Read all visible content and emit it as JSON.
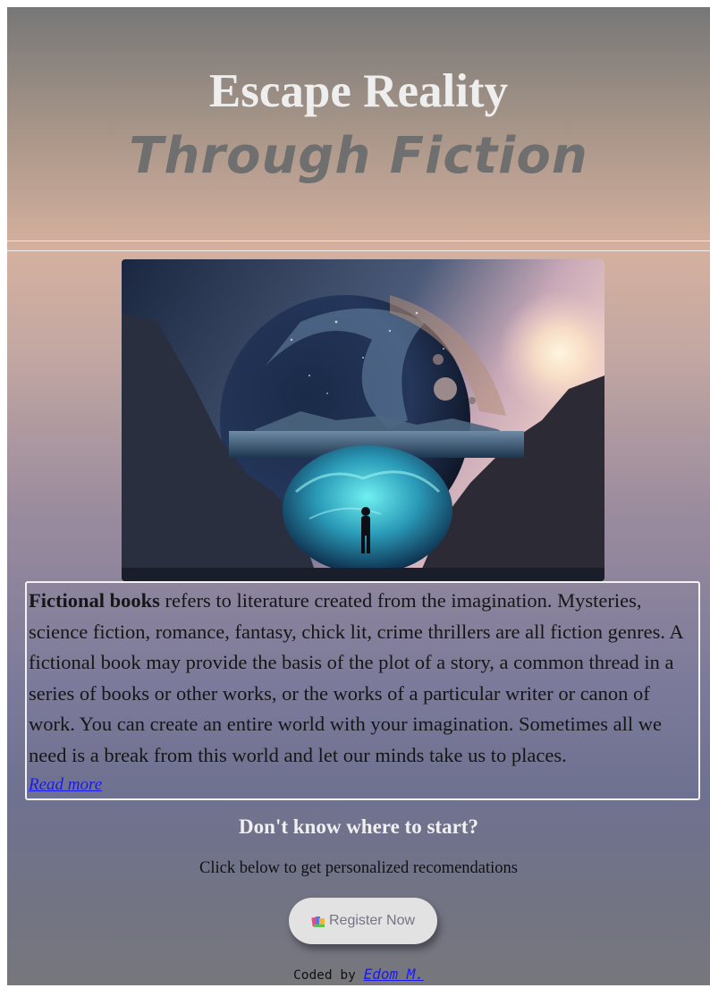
{
  "header": {
    "title_line1": "Escape Reality",
    "title_line2": "Through Fiction"
  },
  "hero_image": {
    "icon": "fantasy-portal-illustration"
  },
  "intro": {
    "bold_lead": "Fictional books",
    "body": " refers to literature created from the imagination. Mysteries, science fiction, romance, fantasy, chick lit, crime thrillers are all fiction genres. A fictional book may provide the basis of the plot of a story, a common thread in a series of books or other works, or the works of a particular writer or canon of work. You can create an entire world with your imagination. Sometimes all we need is a break from this world and let our minds take us to places.",
    "read_more_label": "Read more"
  },
  "cta": {
    "heading": "Don't know where to start?",
    "subtext": "Click below to get personalized recomendations",
    "button_icon": "books-icon",
    "button_label": "Register Now"
  },
  "footer": {
    "prefix": "Coded by ",
    "author_link": "Edom M."
  },
  "colors": {
    "link": "#1a1aee",
    "title_light": "#eeeeee",
    "title_dark": "#6f6f6f"
  }
}
